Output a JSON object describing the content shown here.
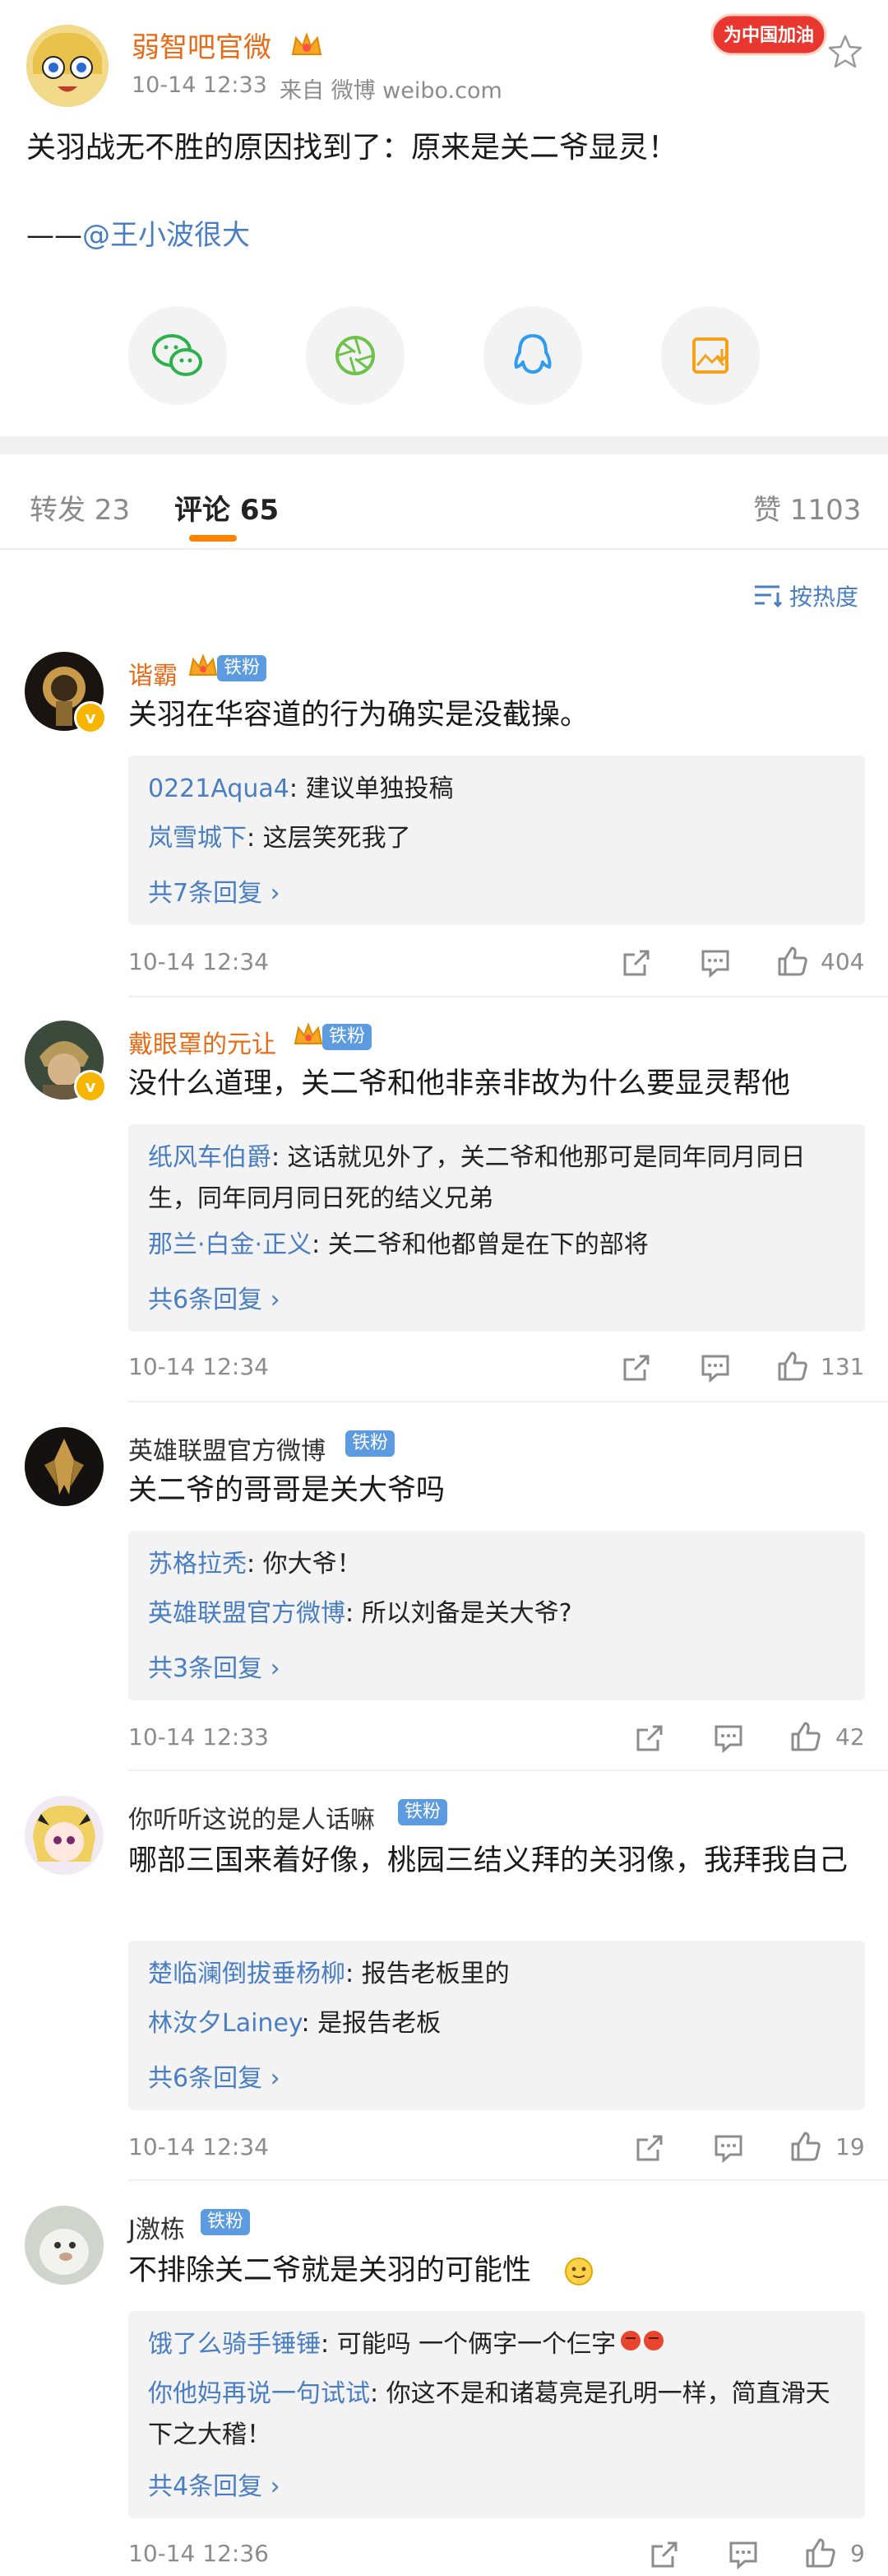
{
  "post": {
    "author": "弱智吧官微",
    "time": "10-14 12:33",
    "source": "来自 微博 weibo.com",
    "text": "关羽战无不胜的原因找到了：原来是关二爷显灵！",
    "credit_prefix": "——",
    "credit_mention": "@王小波很大",
    "badge": "为中国加油"
  },
  "tabs": {
    "reposts": "转发 23",
    "comments": "评论 65",
    "likes": "赞 1103"
  },
  "sort_label": "按热度",
  "comments": [
    {
      "name": "谐霸",
      "badge": "铁粉",
      "text": "关羽在华容道的行为确实是没截操。",
      "replies": [
        {
          "name": "0221Aqua4",
          "text": ": 建议单独投稿"
        },
        {
          "name": "岚雪城下",
          "text": ": 这层笑死我了"
        }
      ],
      "more": "共7条回复 ›",
      "time": "10-14 12:34",
      "likes": "404"
    },
    {
      "name": "戴眼罩的元让",
      "badge": "铁粉",
      "text": "没什么道理，关二爷和他非亲非故为什么要显灵帮他",
      "replies": [
        {
          "name": "纸风车伯爵",
          "text": ": 这话就见外了，关二爷和他那可是同年同月同日生，同年同月同日死的结义兄弟"
        },
        {
          "name": "那兰·白金·正义",
          "text": ": 关二爷和他都曾是在下的部将"
        }
      ],
      "more": "共6条回复 ›",
      "time": "10-14 12:34",
      "likes": "131"
    },
    {
      "name": "英雄联盟官方微博",
      "badge": "铁粉",
      "text": "关二爷的哥哥是关大爷吗",
      "replies": [
        {
          "name": "苏格拉秃",
          "text": ": 你大爷！"
        },
        {
          "name": "英雄联盟官方微博",
          "text": ": 所以刘备是关大爷?"
        }
      ],
      "more": "共3条回复 ›",
      "time": "10-14 12:33",
      "likes": "42"
    },
    {
      "name": "你听听这说的是人话嘛",
      "badge": "铁粉",
      "text": "哪部三国来着好像，桃园三结义拜的关羽像，我拜我自己",
      "replies": [
        {
          "name": "楚临澜倒拔垂杨柳",
          "text": ": 报告老板里的"
        },
        {
          "name": "林汝夕Lainey",
          "text": ": 是报告老板"
        }
      ],
      "more": "共6条回复 ›",
      "time": "10-14 12:34",
      "likes": "19"
    },
    {
      "name": "J激栋",
      "badge": "铁粉",
      "text": "不排除关二爷就是关羽的可能性",
      "replies": [
        {
          "name": "饿了么骑手锤锤",
          "text": ": 可能吗 一个俩字一个仨字"
        },
        {
          "name": "你他妈再说一句试试",
          "text": ": 你这不是和诸葛亮是孔明一样，简直滑天下之大稽！"
        }
      ],
      "more": "共4条回复 ›",
      "time": "10-14 12:36",
      "likes": "9"
    }
  ]
}
